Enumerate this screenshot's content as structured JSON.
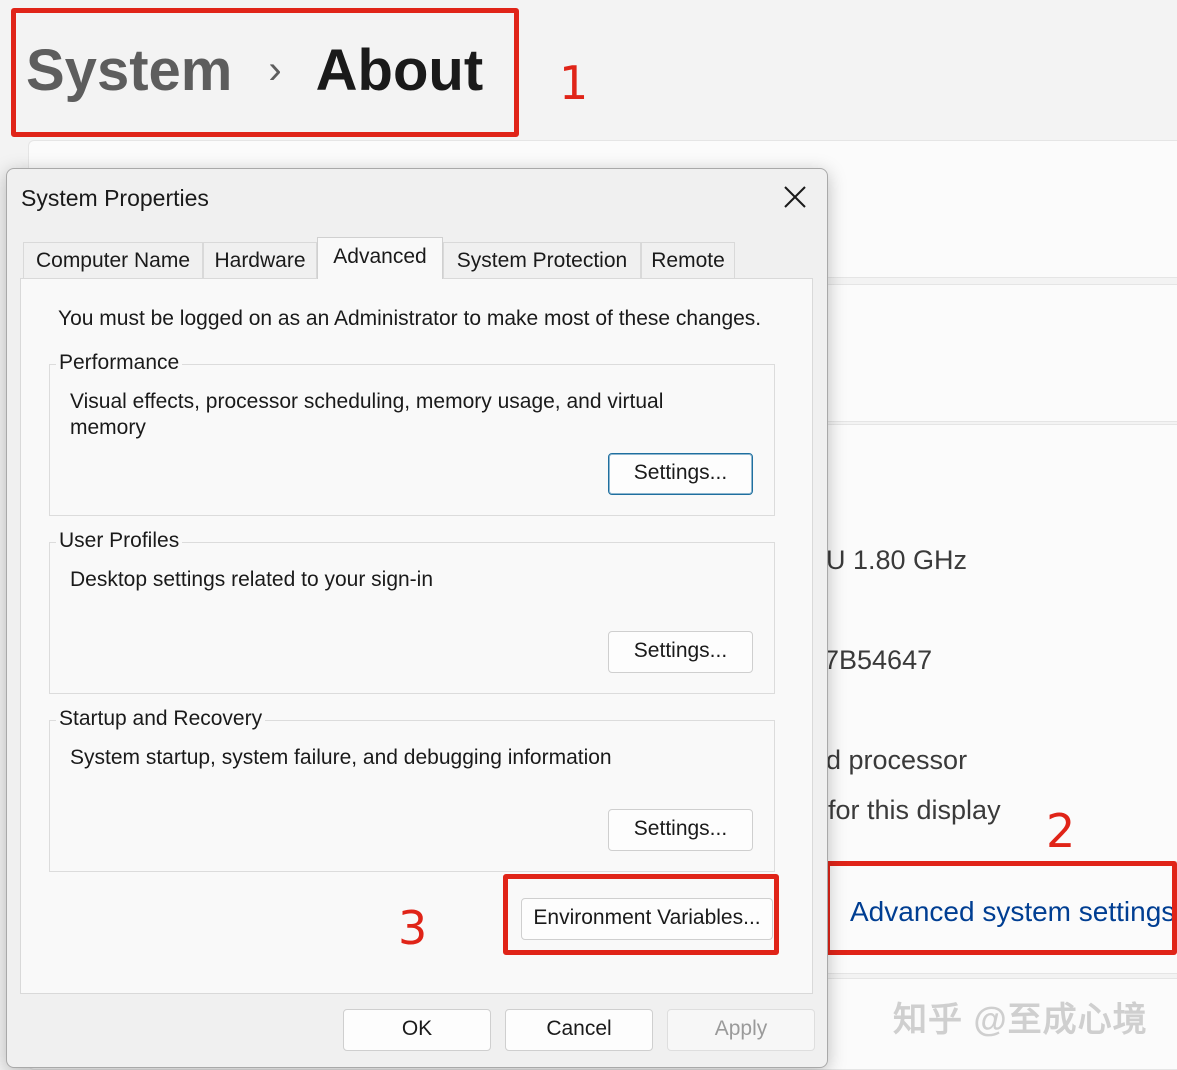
{
  "breadcrumb": {
    "parent": "System",
    "separator": "›",
    "current": "About"
  },
  "background": {
    "partial_lines": [
      {
        "id": "cpu",
        "text": "U   1.80 GHz"
      },
      {
        "id": "id",
        "text": "7B54647"
      },
      {
        "id": "system-type",
        "text": "d processor"
      },
      {
        "id": "pen-touch",
        "text": "for this display"
      }
    ],
    "advanced_link": "Advanced system settings",
    "watermark": "知乎 @至成心境"
  },
  "annotations": [
    "1",
    "2",
    "3"
  ],
  "dialog": {
    "title": "System Properties",
    "tabs": [
      {
        "label": "Computer Name"
      },
      {
        "label": "Hardware"
      },
      {
        "label": "Advanced"
      },
      {
        "label": "System Protection"
      },
      {
        "label": "Remote"
      }
    ],
    "active_tab": "Advanced",
    "admin_message": "You must be logged on as an Administrator to make most of these changes.",
    "groups": [
      {
        "title": "Performance",
        "description": "Visual effects, processor scheduling, memory usage, and virtual memory",
        "button": "Settings..."
      },
      {
        "title": "User Profiles",
        "description": "Desktop settings related to your sign-in",
        "button": "Settings..."
      },
      {
        "title": "Startup and Recovery",
        "description": "System startup, system failure, and debugging information",
        "button": "Settings..."
      }
    ],
    "env_button": "Environment Variables...",
    "footer": {
      "ok": "OK",
      "cancel": "Cancel",
      "apply": "Apply"
    }
  },
  "colors": {
    "annotation": "#e02418",
    "link": "#003e92",
    "focus": "#1f6f9f"
  }
}
